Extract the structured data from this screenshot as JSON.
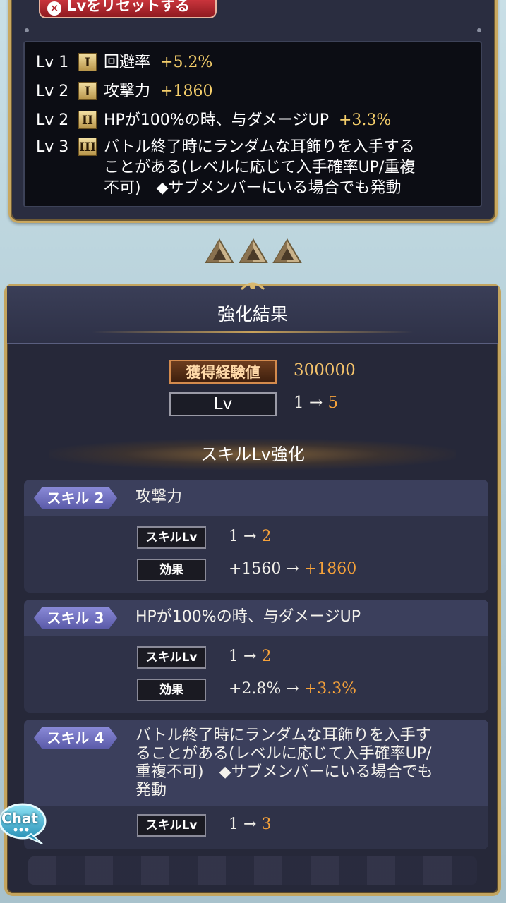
{
  "top_panel": {
    "reset_button": "Lvをリセットする",
    "skills": [
      {
        "lv": "Lv 1",
        "rank": "I",
        "desc": "回避率",
        "value": "+5.2%"
      },
      {
        "lv": "Lv 2",
        "rank": "I",
        "desc": "攻撃力",
        "value": "+1860"
      },
      {
        "lv": "Lv 2",
        "rank": "II",
        "desc": "HPが100%の時、与ダメージUP",
        "value": "+3.3%"
      },
      {
        "lv": "Lv 3",
        "rank": "III",
        "desc_lines": [
          "バトル終了時にランダムな耳飾りを入手する",
          "ことがある(レベルに応じて入手確率UP/重複",
          "不可)　◆サブメンバーにいる場合でも発動"
        ]
      }
    ]
  },
  "result": {
    "title": "強化結果",
    "exp_label": "獲得経験値",
    "exp_value": "300000",
    "lv_label": "Lv",
    "lv_from": "1 →",
    "lv_to": "5",
    "skill_section_title": "スキルLv強化",
    "cards": [
      {
        "tag": "スキル 2",
        "title_lines": [
          "攻撃力"
        ],
        "rows": [
          {
            "label": "スキルLv",
            "from": "1 →",
            "to": "2"
          },
          {
            "label": "効果",
            "from": "+1560 →",
            "to": "+1860"
          }
        ]
      },
      {
        "tag": "スキル 3",
        "title_lines": [
          "HPが100%の時、与ダメージUP"
        ],
        "rows": [
          {
            "label": "スキルLv",
            "from": "1 →",
            "to": "2"
          },
          {
            "label": "効果",
            "from": "+2.8% →",
            "to": "+3.3%"
          }
        ]
      },
      {
        "tag": "スキル 4",
        "title_lines": [
          "バトル終了時にランダムな耳飾りを入手す",
          "ることがある(レベルに応じて入手確率UP/",
          "重複不可)　◆サブメンバーにいる場合でも",
          "発動"
        ],
        "rows": [
          {
            "label": "スキルLv",
            "from": "1 →",
            "to": "3"
          }
        ]
      }
    ]
  },
  "chat": {
    "label": "Chat"
  },
  "colors": {
    "gold_value": "#f6cf6b",
    "orange_value": "#f6a23a",
    "frame_gold": "#c3a45e"
  }
}
